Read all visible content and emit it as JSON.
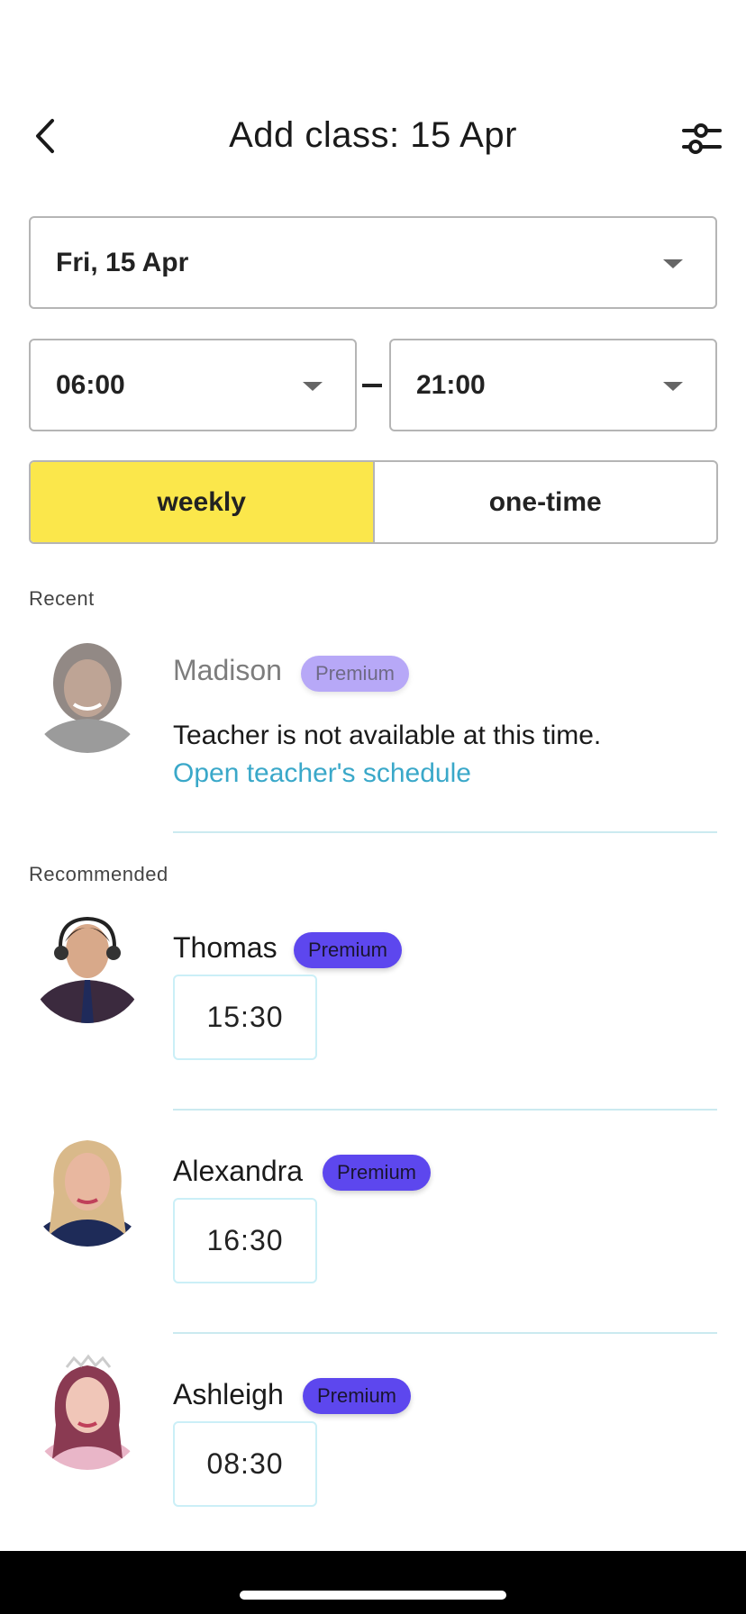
{
  "header": {
    "title": "Add class: 15 Apr",
    "back_icon": "chevron-left-icon",
    "filter_icon": "sliders-icon"
  },
  "date_select": {
    "value": "Fri, 15 Apr"
  },
  "time_range": {
    "start": "06:00",
    "separator": "–",
    "end": "21:00"
  },
  "frequency": {
    "options": [
      "weekly",
      "one-time"
    ],
    "selected": "weekly",
    "active_color": "#fbe74b"
  },
  "recent": {
    "label": "Recent",
    "teachers": [
      {
        "name": "Madison",
        "badge": "Premium",
        "message": "Teacher is not available at this time.",
        "link": "Open teacher's schedule"
      }
    ]
  },
  "recommended": {
    "label": "Recommended",
    "teachers": [
      {
        "name": "Thomas",
        "badge": "Premium",
        "slot": "15:30"
      },
      {
        "name": "Alexandra",
        "badge": "Premium",
        "slot": "16:30"
      },
      {
        "name": "Ashleigh",
        "badge": "Premium",
        "slot": "08:30"
      }
    ]
  },
  "colors": {
    "premium_badge": "#5d47ee",
    "link": "#3aa8c9",
    "divider": "#cbeaf0"
  }
}
